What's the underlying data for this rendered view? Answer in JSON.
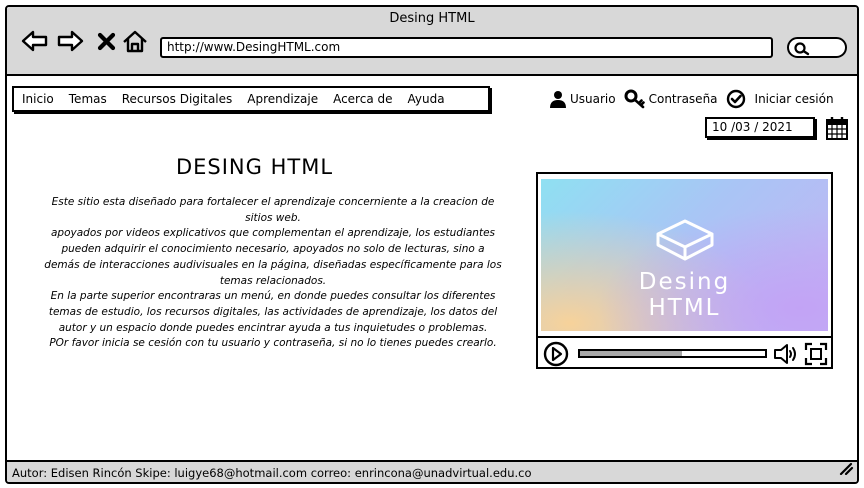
{
  "window": {
    "title": "Desing HTML"
  },
  "toolbar": {
    "back_icon": "back-arrow-icon",
    "forward_icon": "forward-arrow-icon",
    "close_icon": "x-icon",
    "home_icon": "home-icon",
    "url": "http://www.DesingHTML.com",
    "search_icon": "search-icon"
  },
  "menu": {
    "items": [
      "Inicio",
      "Temas",
      "Recursos Digitales",
      "Aprendizaje",
      "Acerca de",
      "Ayuda"
    ]
  },
  "login": {
    "user_label": "Usuario",
    "password_label": "Contraseña",
    "signin_label": "Iniciar cesión"
  },
  "date": {
    "value": "10 /03  / 2021"
  },
  "main": {
    "title": "DESING HTML",
    "paragraphs": [
      "Este sitio esta diseñado para fortalecer el aprendizaje concerniente a la creacion de sitios web.",
      "apoyados por videos explicativos que complementan el aprendizaje, los estudiantes pueden adquirir el conocimiento necesario, apoyados no solo de lecturas, sino a demás de interacciones audivisuales en la página, diseñadas específicamente para los temas relacionados.",
      "En la parte superior encontraras un menú, en donde puedes consultar los diferentes temas de estudio, los recursos digitales, las actividades de aprendizaje, los datos del autor y un espacio donde puedes encintrar ayuda a tus inquietudes o problemas.",
      "POr favor inicia se cesión con tu usuario y contraseña, si no lo tienes puedes crearlo."
    ]
  },
  "video": {
    "logo_line1": "Desing",
    "logo_line2": "HTML",
    "progress": 0.55,
    "gradient_colors": [
      "#8fe0f2",
      "#a9c5f5",
      "#c5b2f4",
      "#f7d29a"
    ]
  },
  "footer": {
    "text": "Autor: Edisen Rincón Skipe: luigye68@hotmail.com correo: enrincona@unadvirtual.edu.co"
  }
}
